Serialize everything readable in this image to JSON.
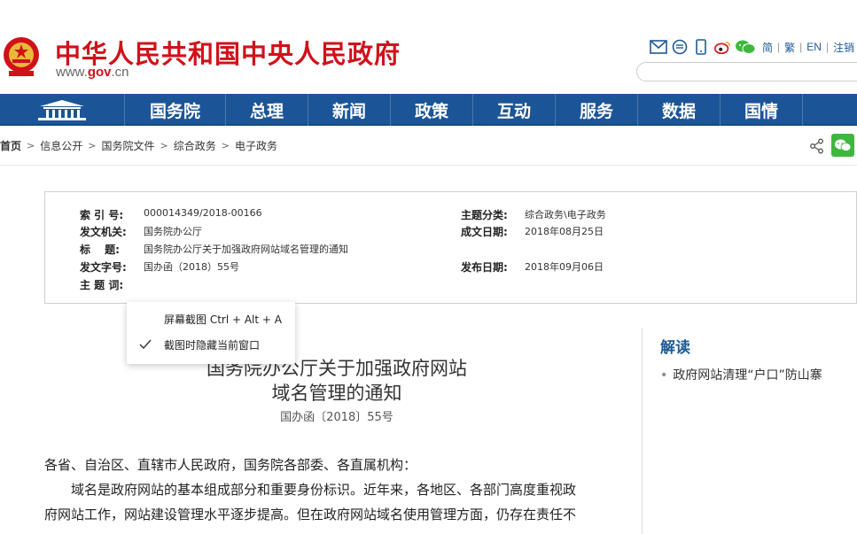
{
  "header": {
    "title": "中华人民共和国中央人民政府",
    "url_prefix": "www.",
    "url_domain": "gov",
    "url_suffix": ".cn",
    "tools": [
      "mail-icon",
      "chat-icon",
      "mobile-icon",
      "weibo-icon",
      "wechat-icon"
    ],
    "languages": [
      {
        "label": "简"
      },
      {
        "label": "繁"
      },
      {
        "label": "EN"
      },
      {
        "label": "注销"
      }
    ],
    "search_placeholder": ""
  },
  "nav": {
    "items": [
      "国务院",
      "总理",
      "新闻",
      "政策",
      "互动",
      "服务",
      "数据",
      "国情"
    ]
  },
  "breadcrumb": [
    "首页",
    "信息公开",
    "国务院文件",
    "综合政务",
    "电子政务"
  ],
  "info": {
    "index_label": "索 引 号:",
    "index_value": "000014349/2018-00166",
    "category_label": "主题分类:",
    "category_value": "综合政务\\电子政务",
    "issuer_label": "发文机关:",
    "issuer_value": "国务院办公厅",
    "created_label": "成文日期:",
    "created_value": "2018年08月25日",
    "title_label": "标　 题:",
    "title_value": "国务院办公厅关于加强政府网站域名管理的通知",
    "docno_label": "发文字号:",
    "docno_value": "国办函（2018）55号",
    "published_label": "发布日期:",
    "published_value": "2018年09月06日",
    "keywords_label": "主 题 词:",
    "keywords_value": ""
  },
  "article": {
    "title_line1": "国务院办公厅关于加强政府网站",
    "title_line2": "域名管理的通知",
    "docno": "国办函〔2018〕55号",
    "greeting": "各省、自治区、直辖市人民政府，国务院各部委、各直属机构：",
    "para1_line1": "　　域名是政府网站的基本组成部分和重要身份标识。近年来，各地区、各部门高度重视政",
    "para1_line2": "府网站工作，网站建设管理水平逐步提高。但在政府网站域名使用管理方面，仍存在责任不"
  },
  "side": {
    "heading": "解读",
    "item1": "政府网站清理“户口”防山寨"
  },
  "context_menu": {
    "items": [
      {
        "label": "屏幕截图 Ctrl + Alt + A",
        "checked": false
      },
      {
        "label": "截图时隐藏当前窗口",
        "checked": true
      }
    ]
  },
  "colors": {
    "brand_red": "#d1111a",
    "nav_blue": "#1c5597",
    "link_blue": "#1f5a94",
    "wechat_green": "#3fb73e"
  }
}
